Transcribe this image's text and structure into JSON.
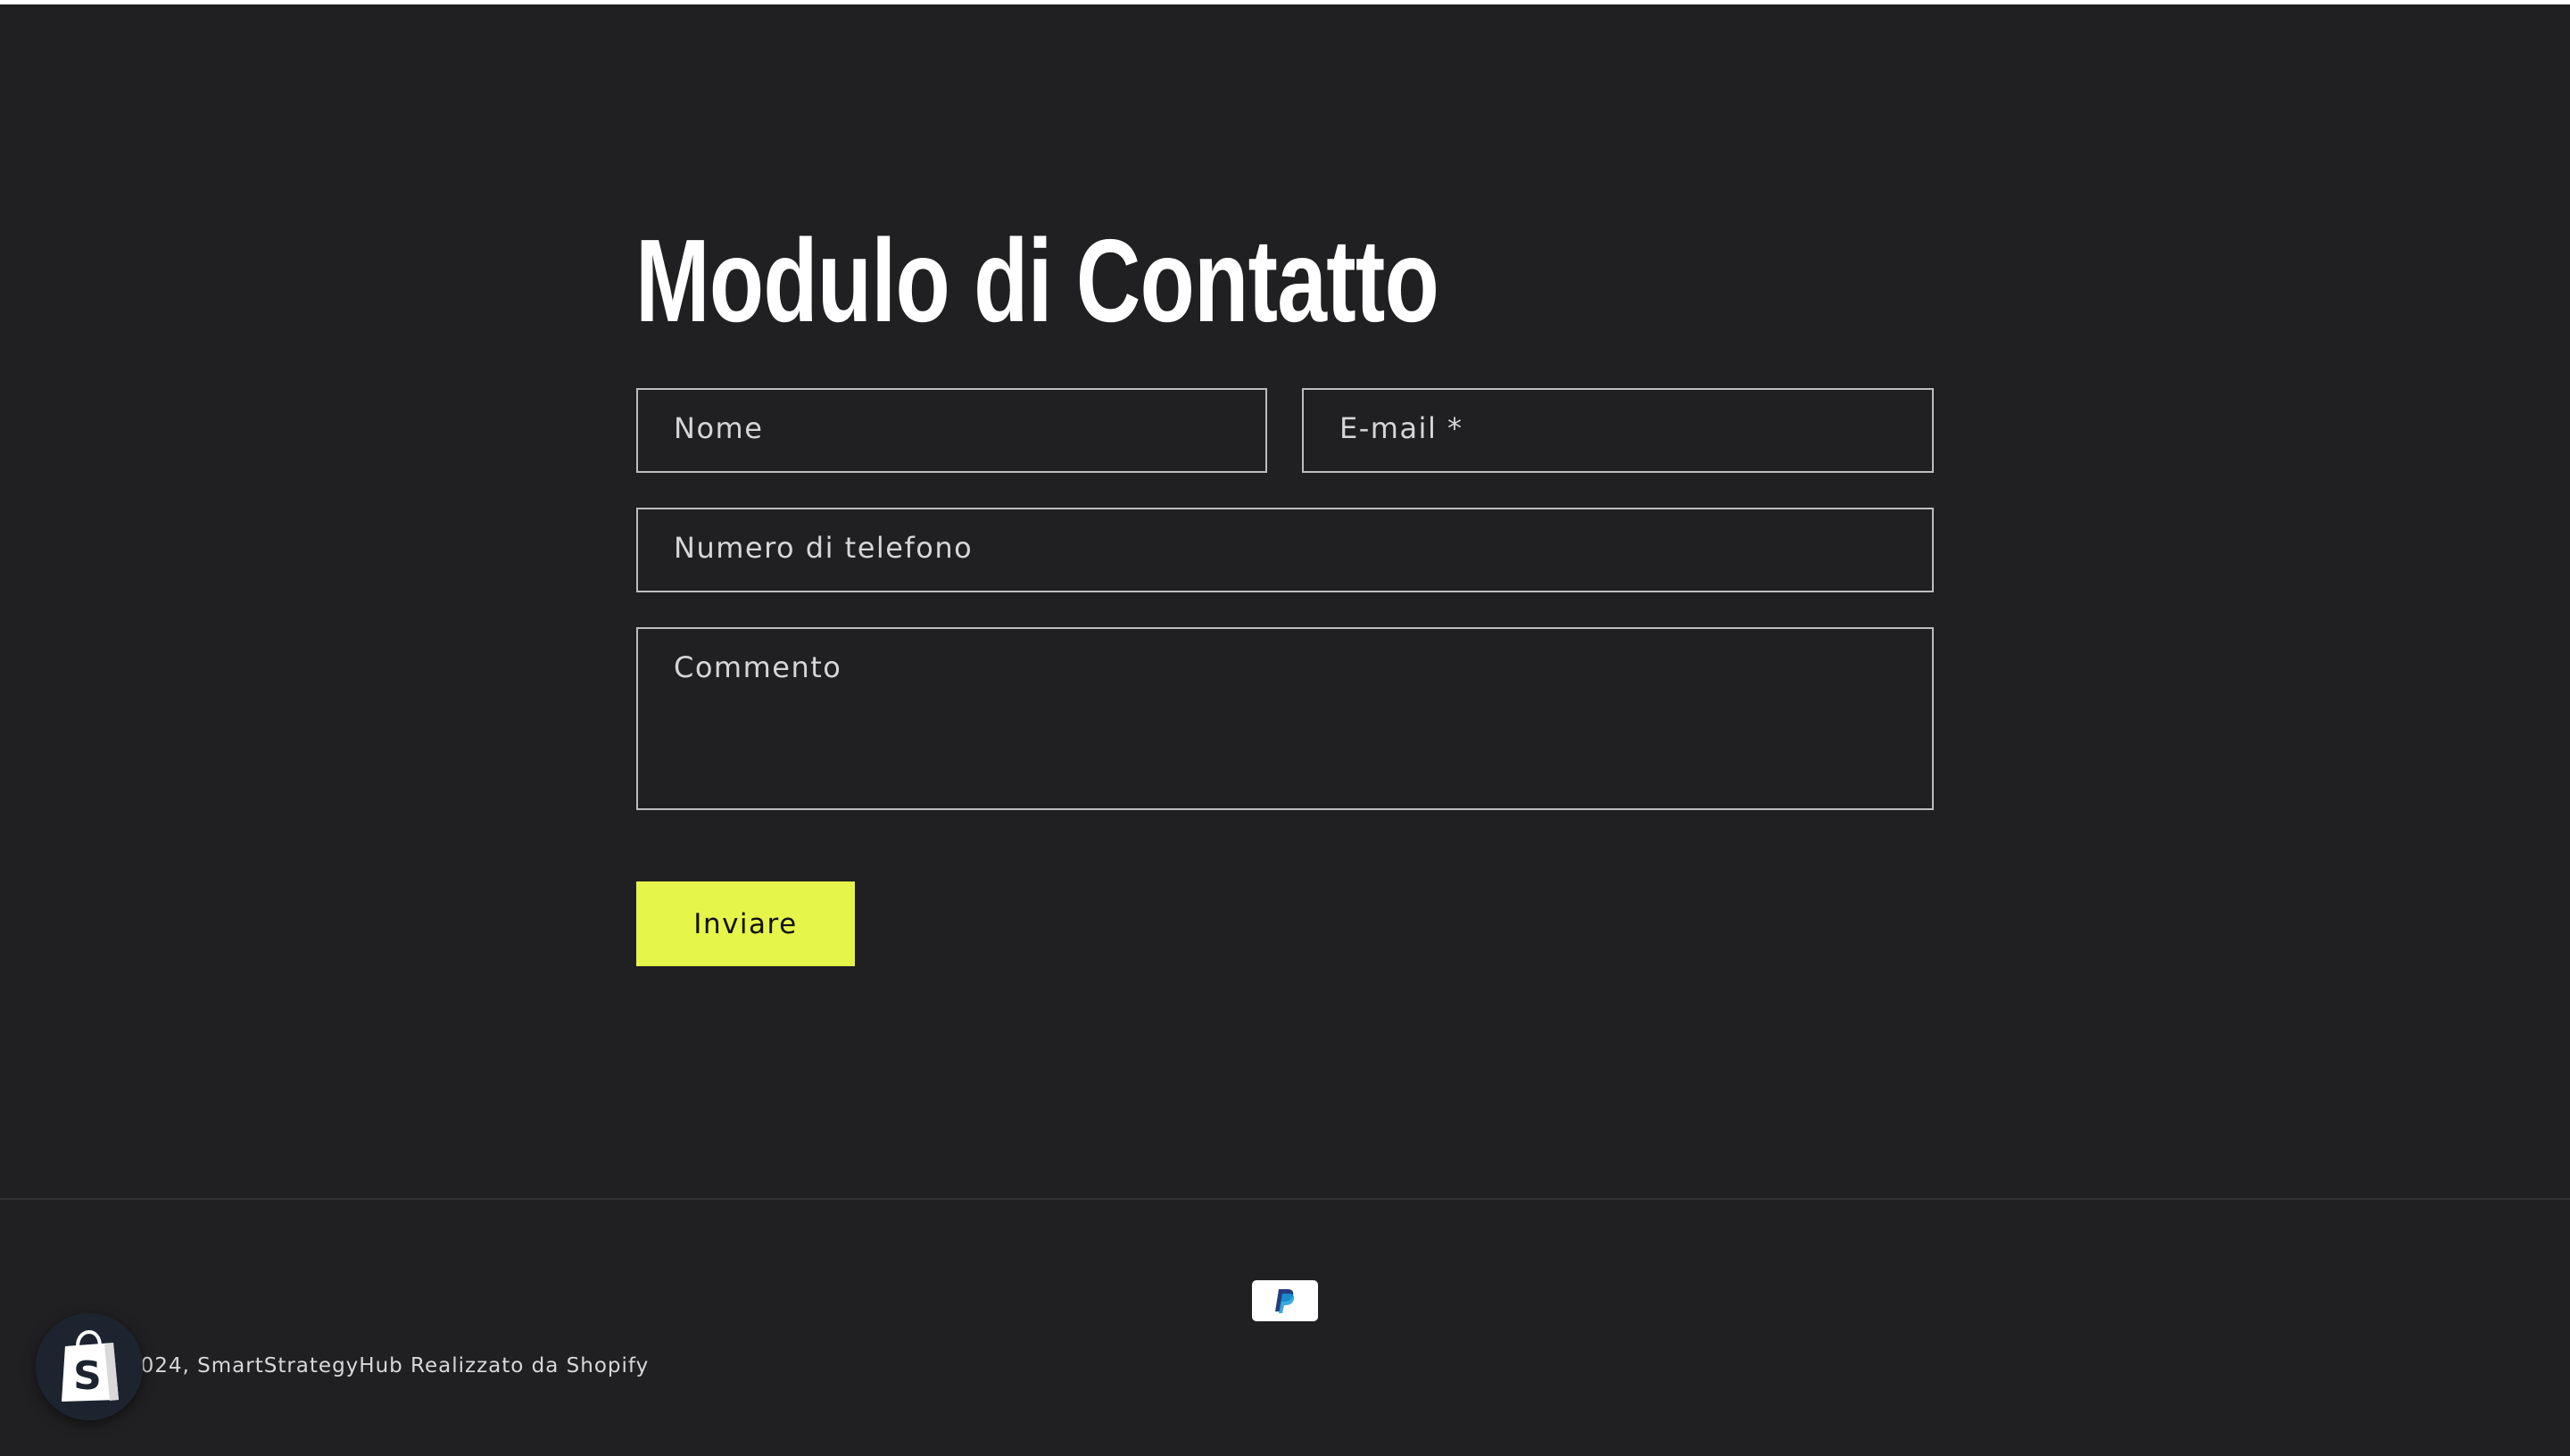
{
  "page": {
    "title": "Modulo di Contatto"
  },
  "form": {
    "name_label": "Nome",
    "email_label": "E-mail *",
    "phone_label": "Numero di telefono",
    "comment_label": "Commento",
    "submit_label": "Inviare"
  },
  "footer": {
    "payment_icon": "paypal-icon",
    "copyright_text": "©2024, SmartStrategyHub Realizzato da Shopify"
  },
  "shopify_badge": {
    "icon": "shopify-bag-icon"
  },
  "colors": {
    "background": "#202022",
    "accent": "#e6f54a",
    "field_border": "#bdbdbf",
    "text": "#ffffff"
  }
}
